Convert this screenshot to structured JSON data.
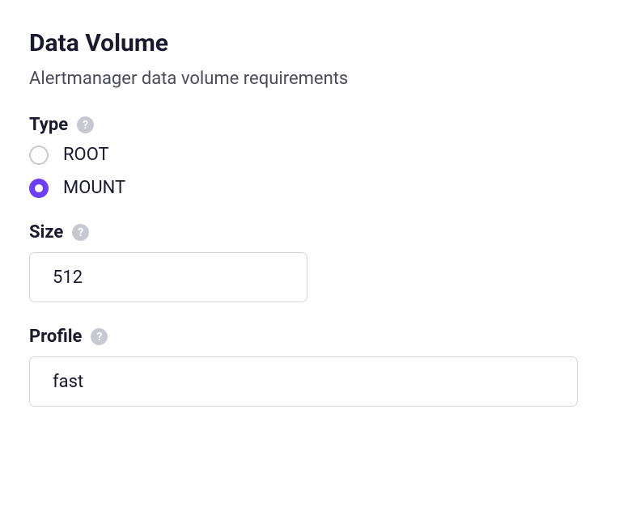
{
  "section": {
    "title": "Data Volume",
    "description": "Alertmanager data volume requirements"
  },
  "type": {
    "label": "Type",
    "options": [
      {
        "label": "ROOT",
        "selected": false
      },
      {
        "label": "MOUNT",
        "selected": true
      }
    ]
  },
  "size": {
    "label": "Size",
    "value": "512"
  },
  "profile": {
    "label": "Profile",
    "value": "fast"
  }
}
